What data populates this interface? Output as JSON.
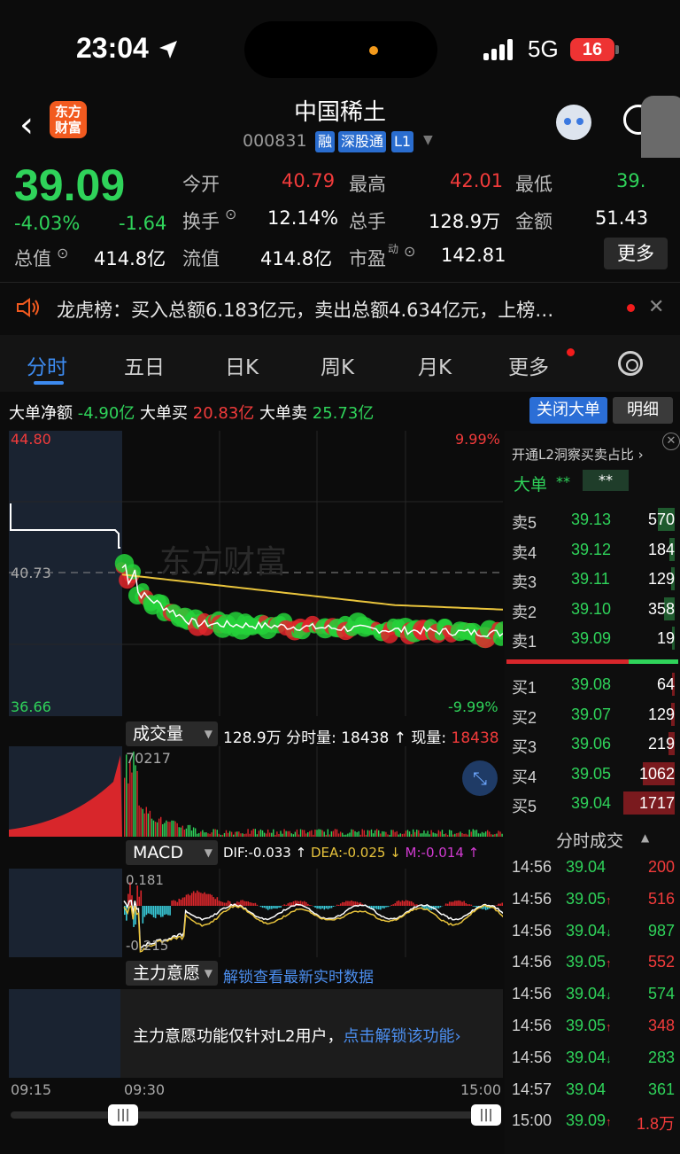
{
  "status_bar": {
    "time": "23:04",
    "network": "5G",
    "battery": "16"
  },
  "header": {
    "logo_line1": "东方",
    "logo_line2": "财富",
    "title": "中国稀土",
    "code": "000831",
    "tags": [
      "融",
      "深股通",
      "L1"
    ]
  },
  "quote": {
    "price": "39.09",
    "change_pct": "-4.03%",
    "change": "-1.64",
    "open_label": "今开",
    "open": "40.79",
    "high_label": "最高",
    "high": "42.01",
    "low_label": "最低",
    "low": "39.",
    "turnover_label": "换手",
    "turnover": "12.14%",
    "total_hands_label": "总手",
    "total_hands": "128.9万",
    "amount_label": "金额",
    "amount": "51.43",
    "total_value_label": "总值",
    "total_value": "414.8亿",
    "float_value_label": "流值",
    "float_value": "414.8亿",
    "pe_label": "市盈",
    "pe_sup": "动",
    "pe": "142.81",
    "more": "更多"
  },
  "dragon_tiger": {
    "text": "龙虎榜：买入总额6.183亿元，卖出总额4.634亿元，上榜…"
  },
  "tabs": [
    "分时",
    "五日",
    "日K",
    "周K",
    "月K",
    "更多"
  ],
  "big_order": {
    "net_label": "大单净额",
    "net": "-4.90亿",
    "buy_label": "大单买",
    "buy": "20.83亿",
    "sell_label": "大单卖",
    "sell": "25.73亿",
    "close_btn": "关闭大单",
    "detail_btn": "明细"
  },
  "intraday": {
    "max": "44.80",
    "max_pct": "9.99%",
    "mid": "40.73",
    "min": "36.66",
    "min_pct": "-9.99%",
    "watermark": "东方财富"
  },
  "volume": {
    "selector": "成交量",
    "total": "128.9万",
    "intraday_label": "分时量:",
    "intraday": "18438",
    "current_label": "现量:",
    "current": "18438",
    "peak": "70217"
  },
  "macd": {
    "selector": "MACD",
    "dif_label": "DIF:",
    "dif": "-0.033",
    "dea_label": "DEA:",
    "dea": "-0.025",
    "m_label": "M:",
    "m": "-0.014",
    "top": "0.181",
    "bottom": "-0.215"
  },
  "main_force": {
    "selector": "主力意愿",
    "unlock": "解锁查看最新实时数据",
    "notice": "主力意愿功能仅针对L2用户，",
    "notice_link": "点击解锁该功能"
  },
  "time_axis": {
    "start": "09:15",
    "open": "09:30",
    "end": "15:00"
  },
  "order_book": {
    "l2_banner": "开通L2洞察买卖占比",
    "big_label": "大单",
    "big_value1": "**",
    "big_value2": "**",
    "asks": [
      {
        "label": "卖5",
        "price": "39.13",
        "vol": "570"
      },
      {
        "label": "卖4",
        "price": "39.12",
        "vol": "184"
      },
      {
        "label": "卖3",
        "price": "39.11",
        "vol": "129"
      },
      {
        "label": "卖2",
        "price": "39.10",
        "vol": "358"
      },
      {
        "label": "卖1",
        "price": "39.09",
        "vol": "19"
      }
    ],
    "bids": [
      {
        "label": "买1",
        "price": "39.08",
        "vol": "64"
      },
      {
        "label": "买2",
        "price": "39.07",
        "vol": "129"
      },
      {
        "label": "买3",
        "price": "39.06",
        "vol": "219"
      },
      {
        "label": "买4",
        "price": "39.05",
        "vol": "1062"
      },
      {
        "label": "买5",
        "price": "39.04",
        "vol": "1717"
      }
    ],
    "ticks_title": "分时成交",
    "ticks": [
      {
        "time": "14:56",
        "price": "39.04",
        "dir": "",
        "vol": "200",
        "color": "red"
      },
      {
        "time": "14:56",
        "price": "39.05",
        "dir": "↑",
        "vol": "516",
        "color": "red"
      },
      {
        "time": "14:56",
        "price": "39.04",
        "dir": "↓",
        "vol": "987",
        "color": "green"
      },
      {
        "time": "14:56",
        "price": "39.05",
        "dir": "↑",
        "vol": "552",
        "color": "red"
      },
      {
        "time": "14:56",
        "price": "39.04",
        "dir": "↓",
        "vol": "574",
        "color": "green"
      },
      {
        "time": "14:56",
        "price": "39.05",
        "dir": "↑",
        "vol": "348",
        "color": "red"
      },
      {
        "time": "14:56",
        "price": "39.04",
        "dir": "↓",
        "vol": "283",
        "color": "green"
      },
      {
        "time": "14:57",
        "price": "39.04",
        "dir": "",
        "vol": "361",
        "color": "green"
      },
      {
        "time": "15:00",
        "price": "39.09",
        "dir": "↑",
        "vol": "1.8万",
        "color": "red"
      }
    ]
  },
  "colors": {
    "up": "#f23b3b",
    "down": "#2fd35a",
    "accent": "#3d8bf0",
    "avg_line": "#e9c43c"
  }
}
